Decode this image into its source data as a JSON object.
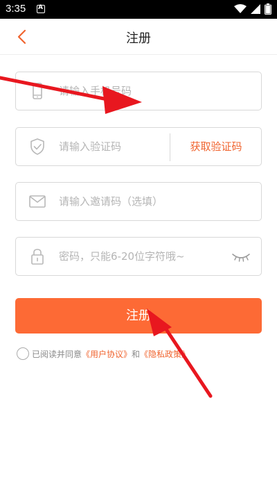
{
  "status_bar": {
    "time": "3:35"
  },
  "header": {
    "title": "注册"
  },
  "form": {
    "phone_placeholder": "请输入手机号码",
    "code_placeholder": "请输入验证码",
    "get_code_label": "获取验证码",
    "invite_placeholder": "请输入邀请码（选填）",
    "password_placeholder": "密码，只能6-20位字符哦~"
  },
  "submit_label": "注册",
  "agreement": {
    "prefix": "已阅读并同意",
    "user_agreement": "《用户协议》",
    "conjunction": "和",
    "privacy_policy": "《隐私政策》"
  },
  "colors": {
    "accent": "#fd6a35",
    "link": "#f0642f",
    "annotation_arrow": "#e8171f"
  },
  "icons": [
    "back-arrow-icon",
    "phone-icon",
    "shield-check-icon",
    "mail-icon",
    "lock-icon",
    "eye-closed-icon",
    "wifi-icon",
    "signal-icon",
    "battery-icon",
    "notification-icon"
  ]
}
